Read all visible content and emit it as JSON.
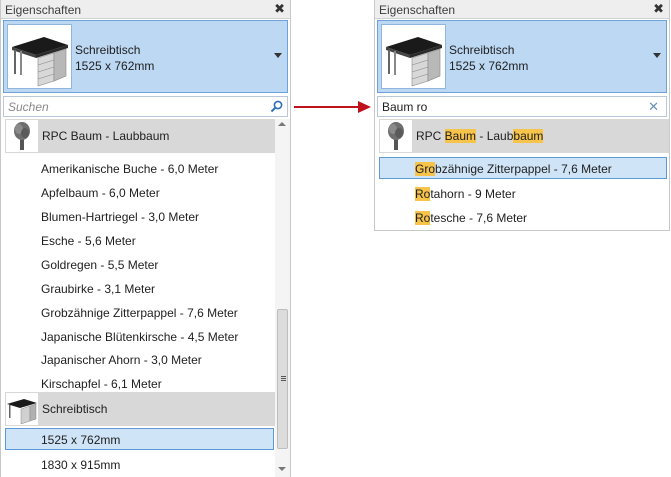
{
  "left_panel": {
    "title": "Eigenschaften",
    "close_glyph": "✖",
    "selector": {
      "name": "Schreibtisch",
      "size": "1525 x 762mm"
    },
    "search": {
      "placeholder": "Suchen"
    },
    "group1": {
      "label": "RPC Baum - Laubbaum",
      "icon": "tree-icon"
    },
    "trees": [
      "Amerikanische Buche - 6,0 Meter",
      "Apfelbaum - 6,0 Meter",
      "Blumen-Hartriegel - 3,0 Meter",
      "Esche - 5,6 Meter",
      "Goldregen - 5,5 Meter",
      "Graubirke - 3,1 Meter",
      "Grobzähnige Zitterpappel - 7,6 Meter",
      "Japanische Blütenkirsche - 4,5 Meter",
      "Japanischer Ahorn - 3,0 Meter",
      "Kirschapfel - 6,1 Meter"
    ],
    "group2": {
      "label": "Schreibtisch",
      "icon": "desk-icon"
    },
    "desks": [
      "1525 x 762mm",
      "1830 x 915mm"
    ]
  },
  "right_panel": {
    "title": "Eigenschaften",
    "close_glyph": "✖",
    "selector": {
      "name": "Schreibtisch",
      "size": "1525 x 762mm"
    },
    "search": {
      "value": "Baum ro",
      "clear_glyph": "✕"
    },
    "group": {
      "pre": "RPC ",
      "hl1": "Baum",
      "mid": " - Laub",
      "hl2": "baum"
    },
    "results": [
      {
        "hl": "G",
        "hl2": "ro",
        "post": "bzähnige Zitterpappel - 7,6 Meter"
      },
      {
        "hl": "Ro",
        "post": "tahorn - 9 Meter"
      },
      {
        "hl": "Ro",
        "post": "tesche - 7,6 Meter"
      }
    ]
  },
  "colors": {
    "accent_blue": "#bcd8f3",
    "highlight": "#f6c34b",
    "arrow_red": "#c0121b"
  }
}
